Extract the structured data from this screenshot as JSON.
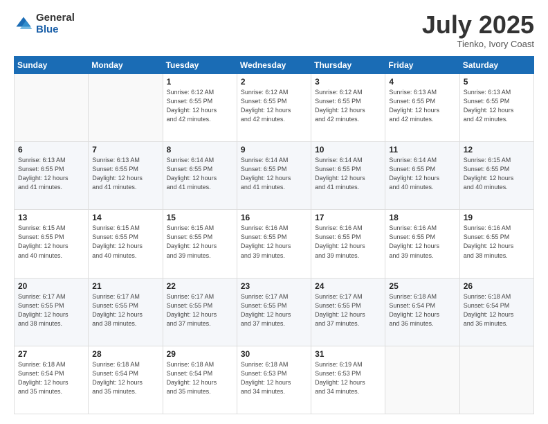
{
  "header": {
    "logo_general": "General",
    "logo_blue": "Blue",
    "month_title": "July 2025",
    "subtitle": "Tienko, Ivory Coast"
  },
  "weekdays": [
    "Sunday",
    "Monday",
    "Tuesday",
    "Wednesday",
    "Thursday",
    "Friday",
    "Saturday"
  ],
  "weeks": [
    [
      {
        "day": "",
        "info": ""
      },
      {
        "day": "",
        "info": ""
      },
      {
        "day": "1",
        "info": "Sunrise: 6:12 AM\nSunset: 6:55 PM\nDaylight: 12 hours\nand 42 minutes."
      },
      {
        "day": "2",
        "info": "Sunrise: 6:12 AM\nSunset: 6:55 PM\nDaylight: 12 hours\nand 42 minutes."
      },
      {
        "day": "3",
        "info": "Sunrise: 6:12 AM\nSunset: 6:55 PM\nDaylight: 12 hours\nand 42 minutes."
      },
      {
        "day": "4",
        "info": "Sunrise: 6:13 AM\nSunset: 6:55 PM\nDaylight: 12 hours\nand 42 minutes."
      },
      {
        "day": "5",
        "info": "Sunrise: 6:13 AM\nSunset: 6:55 PM\nDaylight: 12 hours\nand 42 minutes."
      }
    ],
    [
      {
        "day": "6",
        "info": "Sunrise: 6:13 AM\nSunset: 6:55 PM\nDaylight: 12 hours\nand 41 minutes."
      },
      {
        "day": "7",
        "info": "Sunrise: 6:13 AM\nSunset: 6:55 PM\nDaylight: 12 hours\nand 41 minutes."
      },
      {
        "day": "8",
        "info": "Sunrise: 6:14 AM\nSunset: 6:55 PM\nDaylight: 12 hours\nand 41 minutes."
      },
      {
        "day": "9",
        "info": "Sunrise: 6:14 AM\nSunset: 6:55 PM\nDaylight: 12 hours\nand 41 minutes."
      },
      {
        "day": "10",
        "info": "Sunrise: 6:14 AM\nSunset: 6:55 PM\nDaylight: 12 hours\nand 41 minutes."
      },
      {
        "day": "11",
        "info": "Sunrise: 6:14 AM\nSunset: 6:55 PM\nDaylight: 12 hours\nand 40 minutes."
      },
      {
        "day": "12",
        "info": "Sunrise: 6:15 AM\nSunset: 6:55 PM\nDaylight: 12 hours\nand 40 minutes."
      }
    ],
    [
      {
        "day": "13",
        "info": "Sunrise: 6:15 AM\nSunset: 6:55 PM\nDaylight: 12 hours\nand 40 minutes."
      },
      {
        "day": "14",
        "info": "Sunrise: 6:15 AM\nSunset: 6:55 PM\nDaylight: 12 hours\nand 40 minutes."
      },
      {
        "day": "15",
        "info": "Sunrise: 6:15 AM\nSunset: 6:55 PM\nDaylight: 12 hours\nand 39 minutes."
      },
      {
        "day": "16",
        "info": "Sunrise: 6:16 AM\nSunset: 6:55 PM\nDaylight: 12 hours\nand 39 minutes."
      },
      {
        "day": "17",
        "info": "Sunrise: 6:16 AM\nSunset: 6:55 PM\nDaylight: 12 hours\nand 39 minutes."
      },
      {
        "day": "18",
        "info": "Sunrise: 6:16 AM\nSunset: 6:55 PM\nDaylight: 12 hours\nand 39 minutes."
      },
      {
        "day": "19",
        "info": "Sunrise: 6:16 AM\nSunset: 6:55 PM\nDaylight: 12 hours\nand 38 minutes."
      }
    ],
    [
      {
        "day": "20",
        "info": "Sunrise: 6:17 AM\nSunset: 6:55 PM\nDaylight: 12 hours\nand 38 minutes."
      },
      {
        "day": "21",
        "info": "Sunrise: 6:17 AM\nSunset: 6:55 PM\nDaylight: 12 hours\nand 38 minutes."
      },
      {
        "day": "22",
        "info": "Sunrise: 6:17 AM\nSunset: 6:55 PM\nDaylight: 12 hours\nand 37 minutes."
      },
      {
        "day": "23",
        "info": "Sunrise: 6:17 AM\nSunset: 6:55 PM\nDaylight: 12 hours\nand 37 minutes."
      },
      {
        "day": "24",
        "info": "Sunrise: 6:17 AM\nSunset: 6:55 PM\nDaylight: 12 hours\nand 37 minutes."
      },
      {
        "day": "25",
        "info": "Sunrise: 6:18 AM\nSunset: 6:54 PM\nDaylight: 12 hours\nand 36 minutes."
      },
      {
        "day": "26",
        "info": "Sunrise: 6:18 AM\nSunset: 6:54 PM\nDaylight: 12 hours\nand 36 minutes."
      }
    ],
    [
      {
        "day": "27",
        "info": "Sunrise: 6:18 AM\nSunset: 6:54 PM\nDaylight: 12 hours\nand 35 minutes."
      },
      {
        "day": "28",
        "info": "Sunrise: 6:18 AM\nSunset: 6:54 PM\nDaylight: 12 hours\nand 35 minutes."
      },
      {
        "day": "29",
        "info": "Sunrise: 6:18 AM\nSunset: 6:54 PM\nDaylight: 12 hours\nand 35 minutes."
      },
      {
        "day": "30",
        "info": "Sunrise: 6:18 AM\nSunset: 6:53 PM\nDaylight: 12 hours\nand 34 minutes."
      },
      {
        "day": "31",
        "info": "Sunrise: 6:19 AM\nSunset: 6:53 PM\nDaylight: 12 hours\nand 34 minutes."
      },
      {
        "day": "",
        "info": ""
      },
      {
        "day": "",
        "info": ""
      }
    ]
  ]
}
